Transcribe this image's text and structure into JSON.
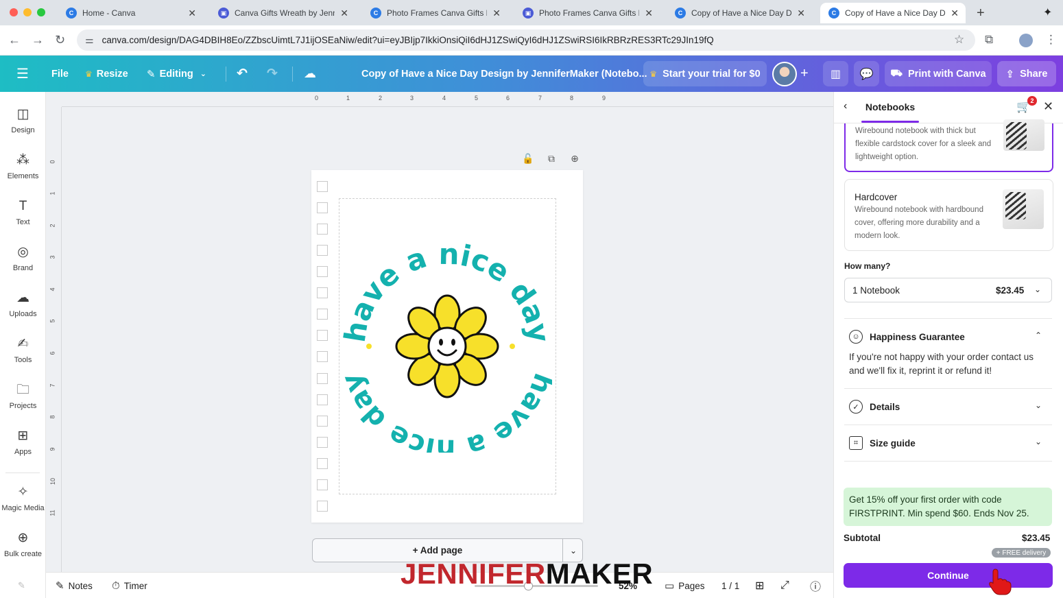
{
  "browser": {
    "tabs": [
      {
        "title": "Home - Canva",
        "favicon_color": "#2c7be5"
      },
      {
        "title": "Canva Gifts Wreath by Jennif",
        "favicon_color": "#4b5bd6"
      },
      {
        "title": "Photo Frames Canva Gifts by",
        "favicon_color": "#2c7be5"
      },
      {
        "title": "Photo Frames Canva Gifts by",
        "favicon_color": "#4b5bd6"
      },
      {
        "title": "Copy of Have a Nice Day Des",
        "favicon_color": "#2c7be5"
      },
      {
        "title": "Copy of Have a Nice Day Des",
        "favicon_color": "#2c7be5"
      }
    ],
    "active_tab": 5,
    "url": "canva.com/design/DAG4DBIH8Eo/ZZbscUimtL7J1ijOSEaNiw/edit?ui=eyJBIjp7IkkiOnsiQiI6dHJ1ZSwiQyI6dHJ1ZSwiRSI6IkRBRzRES3RTc29JIn19fQ",
    "icons": [
      "back-icon",
      "forward-icon",
      "reload-icon",
      "tune-icon",
      "star-icon",
      "cast-icon",
      "profile-icon",
      "more-icon"
    ]
  },
  "toolbar": {
    "menu_label": "File",
    "resize_label": "Resize",
    "editing_label": "Editing",
    "doc_title": "Copy of Have a Nice Day Design by JenniferMaker (Notebo...",
    "trial_label": "Start your trial for $0",
    "print_label": "Print with Canva",
    "share_label": "Share"
  },
  "rail": {
    "items": [
      {
        "label": "Design",
        "icon": "layout-icon"
      },
      {
        "label": "Elements",
        "icon": "shapes-icon"
      },
      {
        "label": "Text",
        "icon": "text-icon"
      },
      {
        "label": "Brand",
        "icon": "brand-icon"
      },
      {
        "label": "Uploads",
        "icon": "upload-icon"
      },
      {
        "label": "Tools",
        "icon": "pen-icon"
      },
      {
        "label": "Projects",
        "icon": "folder-icon"
      },
      {
        "label": "Apps",
        "icon": "apps-icon"
      },
      {
        "label": "Magic Media",
        "icon": "magic-icon"
      },
      {
        "label": "Bulk create",
        "icon": "bulk-icon"
      }
    ]
  },
  "rulers": {
    "top": [
      "0",
      "1",
      "2",
      "3",
      "4",
      "5",
      "6",
      "7",
      "8",
      "9"
    ],
    "left": [
      "0",
      "1",
      "2",
      "3",
      "4",
      "5",
      "6",
      "7",
      "8",
      "9",
      "10",
      "11"
    ]
  },
  "canvas": {
    "art_text_top": "have a nice day",
    "art_text_bottom": "have a nice day",
    "art_color": "#14b1ae",
    "petal_color": "#f7e02a",
    "add_page_label": "+ Add page"
  },
  "bottombar": {
    "notes_label": "Notes",
    "timer_label": "Timer",
    "zoom": "52%",
    "pages_label": "Pages",
    "page_count": "1 / 1"
  },
  "watermark": {
    "part1": "JENNIFER",
    "part2": "MAKER"
  },
  "panel": {
    "tab_label": "Notebooks",
    "cart_count": "2",
    "options": [
      {
        "title": "",
        "desc": "Wirebound notebook with thick but flexible cardstock cover for a sleek and lightweight option.",
        "selected": true
      },
      {
        "title": "Hardcover",
        "desc": "Wirebound notebook with hardbound cover, offering more durability and a modern look.",
        "selected": false
      }
    ],
    "how_many_label": "How many?",
    "quantity": {
      "label": "1 Notebook",
      "price": "$23.45"
    },
    "happiness": {
      "title": "Happiness Guarantee",
      "body": "If you're not happy with your order contact us and we'll fix it, reprint it or refund it!"
    },
    "details_label": "Details",
    "size_guide_label": "Size guide",
    "promo": "Get 15% off your first order with code FIRSTPRINT. Min spend $60. Ends Nov 25.",
    "subtotal_label": "Subtotal",
    "subtotal_value": "$23.45",
    "free_delivery": "+ FREE delivery",
    "continue_label": "Continue",
    "accent": "#7d2ae8"
  }
}
